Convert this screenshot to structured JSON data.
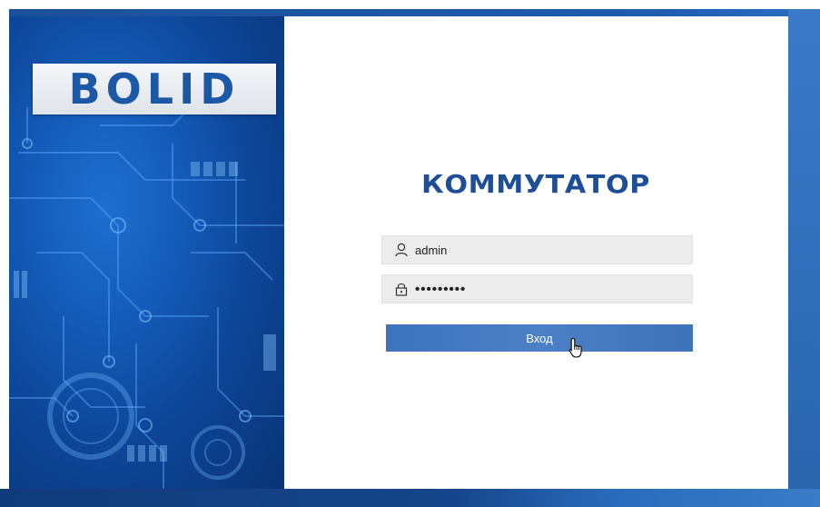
{
  "logo": {
    "text": "BOLID"
  },
  "brand": {
    "title": "КОММУТАТОР"
  },
  "login": {
    "username_value": "admin",
    "password_mask": "•••••••••",
    "submit_label": "Вход"
  },
  "icons": {
    "user": "user-icon",
    "password": "lock-icon",
    "cursor": "hand-pointer-cursor-icon"
  },
  "colors": {
    "brand": "#1e4e98",
    "button": "#4a7fc5",
    "panel_blue": "#145bb8",
    "field_bg": "#ececec"
  }
}
